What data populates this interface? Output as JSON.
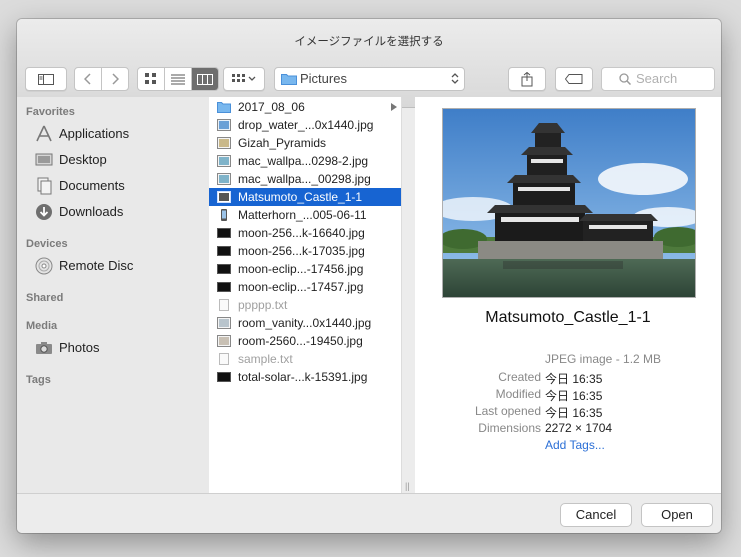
{
  "window": {
    "title": "イメージファイルを選択する"
  },
  "toolbar": {
    "location_label": "Pictures",
    "search_placeholder": "Search",
    "icons": [
      "sidebar-toggle-icon",
      "back-icon",
      "forward-icon",
      "icon-view-icon",
      "list-view-icon",
      "column-view-icon",
      "arrange-icon",
      "share-icon",
      "tag-icon",
      "search-icon"
    ]
  },
  "sidebar": {
    "favorites_header": "Favorites",
    "favorites": [
      {
        "label": "Applications",
        "icon": "applications-icon"
      },
      {
        "label": "Desktop",
        "icon": "desktop-icon"
      },
      {
        "label": "Documents",
        "icon": "documents-icon"
      },
      {
        "label": "Downloads",
        "icon": "downloads-icon"
      }
    ],
    "devices_header": "Devices",
    "devices": [
      {
        "label": "Remote Disc",
        "icon": "disc-icon"
      }
    ],
    "shared_header": "Shared",
    "media_header": "Media",
    "media": [
      {
        "label": "Photos",
        "icon": "camera-icon"
      }
    ],
    "tags_header": "Tags"
  },
  "files": [
    {
      "name": "2017_08_06",
      "kind": "folder"
    },
    {
      "name": "drop_water_...0x1440.jpg",
      "kind": "image"
    },
    {
      "name": "Gizah_Pyramids",
      "kind": "image"
    },
    {
      "name": "mac_wallpa...0298-2.jpg",
      "kind": "image"
    },
    {
      "name": "mac_wallpa..._00298.jpg",
      "kind": "image"
    },
    {
      "name": "Matsumoto_Castle_1-1",
      "kind": "image",
      "selected": true
    },
    {
      "name": "Matterhorn_...005-06-11",
      "kind": "phone"
    },
    {
      "name": "moon-256...k-16640.jpg",
      "kind": "dark"
    },
    {
      "name": "moon-256...k-17035.jpg",
      "kind": "dark"
    },
    {
      "name": "moon-eclip...-17456.jpg",
      "kind": "dark"
    },
    {
      "name": "moon-eclip...-17457.jpg",
      "kind": "dark"
    },
    {
      "name": "ppppp.txt",
      "kind": "text",
      "dim": true
    },
    {
      "name": "room_vanity...0x1440.jpg",
      "kind": "image"
    },
    {
      "name": "room-2560...-19450.jpg",
      "kind": "image"
    },
    {
      "name": "sample.txt",
      "kind": "text",
      "dim": true
    },
    {
      "name": "total-solar-...k-15391.jpg",
      "kind": "dark"
    }
  ],
  "preview": {
    "title": "Matsumoto_Castle_1-1",
    "kind": "JPEG image - 1.2 MB",
    "created_label": "Created",
    "created": "今日 16:35",
    "modified_label": "Modified",
    "modified": "今日 16:35",
    "last_opened_label": "Last opened",
    "last_opened": "今日 16:35",
    "dimensions_label": "Dimensions",
    "dimensions": "2272 × 1704",
    "add_tags": "Add Tags..."
  },
  "buttons": {
    "cancel": "Cancel",
    "open": "Open"
  },
  "colors": {
    "selection": "#1764d2",
    "link": "#2b6fd6"
  }
}
